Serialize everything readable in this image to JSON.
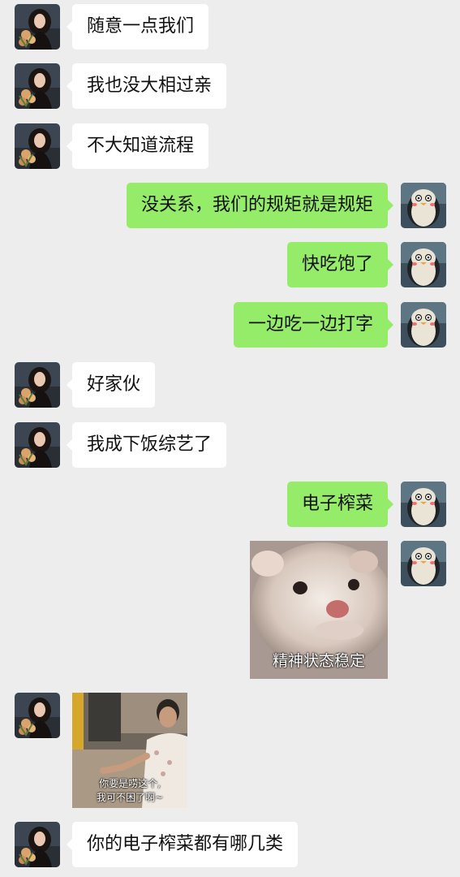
{
  "messages": [
    {
      "side": "left",
      "type": "text",
      "text": "随意一点我们"
    },
    {
      "side": "left",
      "type": "text",
      "text": "我也没大相过亲"
    },
    {
      "side": "left",
      "type": "text",
      "text": "不大知道流程"
    },
    {
      "side": "right",
      "type": "text",
      "text": "没关系，我们的规矩就是规矩"
    },
    {
      "side": "right",
      "type": "text",
      "text": "快吃饱了"
    },
    {
      "side": "right",
      "type": "text",
      "text": "一边吃一边打字"
    },
    {
      "side": "left",
      "type": "text",
      "text": "好家伙"
    },
    {
      "side": "left",
      "type": "text",
      "text": "我成下饭综艺了"
    },
    {
      "side": "right",
      "type": "text",
      "text": "电子榨菜"
    },
    {
      "side": "right",
      "type": "sticker",
      "caption": "精神状态稳定"
    },
    {
      "side": "left",
      "type": "sticker",
      "caption_line1": "你要是唠这个,",
      "caption_line2": "我可不困了啊~"
    },
    {
      "side": "left",
      "type": "text",
      "text": "你的电子榨菜都有哪几类"
    }
  ],
  "colors": {
    "background": "#ededed",
    "incoming_bubble": "#ffffff",
    "outgoing_bubble": "#95ec69"
  },
  "icons": {
    "left_avatar": "woman-with-flowers-avatar-icon",
    "right_avatar": "penguin-avatar-icon"
  }
}
